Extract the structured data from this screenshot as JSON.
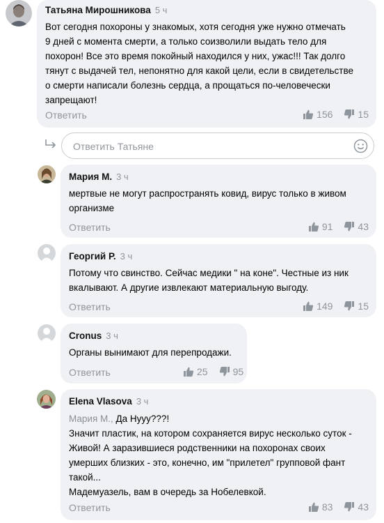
{
  "colors": {
    "bubble": "#eff1f4",
    "muted": "#8f959c"
  },
  "icons": {
    "like": "thumbs-up-icon",
    "dislike": "thumbs-down-icon",
    "reply_arrow": "reply-arrow-icon",
    "emoji": "smiley-icon"
  },
  "comments": [
    {
      "author": "Татьяна Мирошникова",
      "time": "5 ч",
      "lines": [
        "Вот сегодня похороны у знакомых, хотя сегодня уже  нужно отмечать",
        "9 дней с момента смерти, а только соизволили выдать тело для",
        "похорон! Все это время покойный находился у них, ужас!!! Так долго",
        "тянут с выдачей тел, непонятно для какой цели, если в свидетельстве",
        "о смерти написали болезнь сердца, а прощаться по-человечески",
        "запрещают!"
      ],
      "reply_label": "Ответить",
      "likes": "156",
      "dislikes": "15"
    },
    {
      "author": "Мария М.",
      "time": "3 ч",
      "lines": [
        "мертвые не могут распространять ковид, вирус только в живом",
        "организме"
      ],
      "reply_label": "Ответить",
      "likes": "91",
      "dislikes": "43"
    },
    {
      "author": "Георгий Р.",
      "time": "3 ч",
      "lines": [
        "Потому что свинство. Сейчас медики \" на коне\". Честные из ник",
        "вкалывают. А другие извлекают  материальную выгоду."
      ],
      "reply_label": "Ответить",
      "likes": "149",
      "dislikes": "15"
    },
    {
      "author": "Cronus",
      "time": "3 ч",
      "lines": [
        "Органы вынимают для перепродажи."
      ],
      "reply_label": "Ответить",
      "likes": "25",
      "dislikes": "95"
    },
    {
      "author": "Elena Vlasova",
      "time": "3 ч",
      "mention": "Мария М.,",
      "mention_rest": " Да Нууу???!",
      "lines": [
        "Значит пластик, на котором сохраняется вирус несколько суток -",
        "Живой! А заразившиеся родственники на похоронах своих",
        "умерших близких - это, конечно, им \"прилетел\" групповой фант",
        "такой...",
        "Мадемуазель, вам в очередь за Нобелевкой."
      ],
      "reply_label": "Ответить",
      "likes": "83",
      "dislikes": "43"
    }
  ],
  "reply_input": {
    "placeholder": "Ответить Татьяне"
  }
}
